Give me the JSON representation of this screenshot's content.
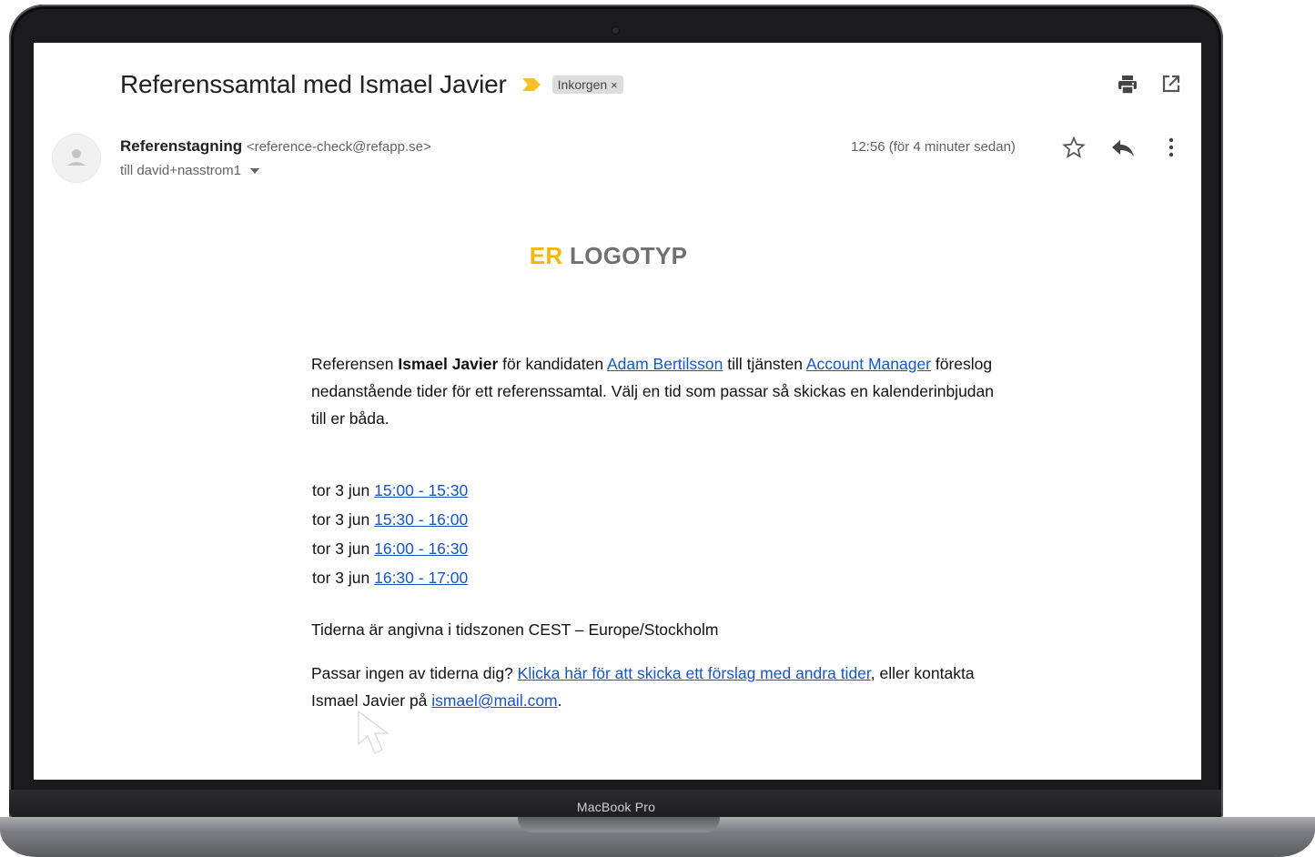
{
  "device": {
    "model_label": "MacBook Pro"
  },
  "email": {
    "subject": "Referenssamtal med Ismael Javier",
    "label_chip": "Inkorgen",
    "label_chip_close": "×",
    "sender_name": "Referenstagning",
    "sender_email": "<reference-check@refapp.se>",
    "to_line": "till david+nasstrom1",
    "timestamp": "12:56 (för 4 minuter sedan)"
  },
  "icons": {
    "importance": "importance-marker-icon",
    "print": "print-icon",
    "popout": "open-in-new-window-icon",
    "avatar": "default-avatar-icon",
    "star": "star-icon",
    "reply": "reply-icon",
    "more": "more-vertical-icon",
    "caret": "dropdown-caret-icon"
  },
  "colors": {
    "link": "#1a55c7",
    "logo_accent": "#f2b705",
    "logo_gray": "#707070",
    "importance": "#f6c026"
  },
  "logo": {
    "part1": "ER",
    "part2": "LOGOTYP"
  },
  "body": {
    "p1_pre": "Referensen ",
    "p1_ref_name": "Ismael Javier",
    "p1_mid1": " för kandidaten ",
    "p1_candidate_link": "Adam Bertilsson",
    "p1_mid2": " till tjänsten ",
    "p1_role_link": "Account Manager",
    "p1_post": " föreslog nedanstående tider för ett referenssamtal. Välj en tid som passar så skickas en kalenderinbjudan till er båda.",
    "slots": [
      {
        "day": "tor 3 jun",
        "time": "15:00 - 15:30"
      },
      {
        "day": "tor 3 jun",
        "time": "15:30 - 16:00"
      },
      {
        "day": "tor 3 jun",
        "time": "16:00 - 16:30"
      },
      {
        "day": "tor 3 jun",
        "time": "16:30 - 17:00"
      }
    ],
    "timezone_note": "Tiderna är angivna i tidszonen CEST – Europe/Stockholm",
    "p3_pre": "Passar ingen av tiderna dig? ",
    "p3_link": "Klicka här för att skicka ett förslag med andra tider",
    "p3_mid": ", eller kontakta Ismael Javier på ",
    "p3_email_link": "ismael@mail.com",
    "p3_post": "."
  }
}
